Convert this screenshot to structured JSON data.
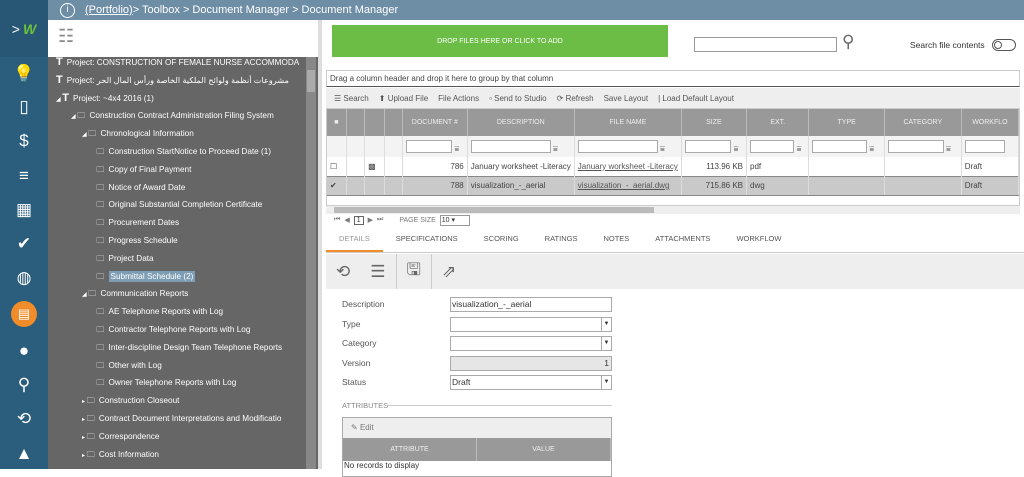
{
  "breadcrumb": {
    "portfolio": "(Portfolio)",
    "rest": " > Toolbox > Document Manager > Document Manager"
  },
  "rail": [
    "lightbulb-icon",
    "document-icon",
    "dollar-icon",
    "bars-icon",
    "building-icon",
    "check-icon",
    "globe-icon",
    "briefcase-icon",
    "user-icon",
    "search-icon",
    "history-icon",
    "graduation-icon"
  ],
  "tree": [
    {
      "label": "Project: CONSTRUCTION OF FEMALE NURSE ACCOMMODA",
      "level": 0,
      "icon": "T"
    },
    {
      "label": "Project: مشروعات أنظمة ولوائح الملكية الخاصة ورأس المال الحر",
      "level": 0,
      "icon": "T"
    },
    {
      "label": "Project: ~4x4 2016 (1)",
      "level": 0,
      "icon": "T",
      "arrow": true
    },
    {
      "label": "Construction Contract Administration Filing System",
      "level": 1,
      "icon": "folder",
      "arrow": true
    },
    {
      "label": "Chronological Information",
      "level": 2,
      "icon": "folder",
      "arrow": true
    },
    {
      "label": "Construction StartNotice to Proceed Date (1)",
      "level": 3,
      "icon": "folder"
    },
    {
      "label": "Copy of Final Payment",
      "level": 3,
      "icon": "folder"
    },
    {
      "label": "Notice of Award Date",
      "level": 3,
      "icon": "folder"
    },
    {
      "label": "Original Substantial Completion Certificate",
      "level": 3,
      "icon": "folder"
    },
    {
      "label": "Procurement Dates",
      "level": 3,
      "icon": "folder"
    },
    {
      "label": "Progress Schedule",
      "level": 3,
      "icon": "folder"
    },
    {
      "label": "Project Data",
      "level": 3,
      "icon": "folder"
    },
    {
      "label": "Submittal Schedule (2)",
      "level": 3,
      "icon": "folder",
      "selected": true
    },
    {
      "label": "Communication Reports",
      "level": 2,
      "icon": "folder",
      "arrow": true
    },
    {
      "label": "AE Telephone Reports with Log",
      "level": 3,
      "icon": "folder"
    },
    {
      "label": "Contractor Telephone Reports with Log",
      "level": 3,
      "icon": "folder"
    },
    {
      "label": "Inter-discipline Design Team Telephone Reports",
      "level": 3,
      "icon": "folder"
    },
    {
      "label": "Other with Log",
      "level": 3,
      "icon": "folder"
    },
    {
      "label": "Owner Telephone Reports with Log",
      "level": 3,
      "icon": "folder"
    },
    {
      "label": "Construction Closeout",
      "level": 2,
      "icon": "folder",
      "collapsed": true
    },
    {
      "label": "Contract Document Interpretations and Modificatio",
      "level": 2,
      "icon": "folder",
      "collapsed": true
    },
    {
      "label": "Correspondence",
      "level": 2,
      "icon": "folder",
      "collapsed": true
    },
    {
      "label": "Cost Information",
      "level": 2,
      "icon": "folder",
      "collapsed": true
    }
  ],
  "drop_label": "DROP FILES HERE OR CLICK TO ADD",
  "search_file_contents": "Search file contents",
  "group_hint": "Drag a column header and drop it here to group by that column",
  "toolbar": {
    "search": "Search",
    "upload": "Upload File",
    "file_actions": "File Actions",
    "send": "Send to Studio",
    "refresh": "Refresh",
    "save_layout": "Save Layout",
    "load_default": "| Load Default Layout"
  },
  "columns": [
    "DOCUMENT #",
    "DESCRIPTION",
    "FILE NAME",
    "SIZE",
    "EXT.",
    "TYPE",
    "CATEGORY",
    "WORKFLO"
  ],
  "rows": [
    {
      "doc": "786",
      "desc": "January worksheet -Literacy",
      "file": "January worksheet -Literacy",
      "size": "113.96 KB",
      "ext": "pdf",
      "type": "",
      "category": "",
      "workflow": "Draft",
      "checked": false
    },
    {
      "doc": "788",
      "desc": "visualization_-_aerial",
      "file": "visualization_-_aerial.dwg",
      "size": "715.86 KB",
      "ext": "dwg",
      "type": "",
      "category": "",
      "workflow": "Draft",
      "checked": true
    }
  ],
  "pager": {
    "page": "1",
    "page_size_label": "PAGE SIZE",
    "page_size": "10"
  },
  "tabs": [
    "DETAILS",
    "SPECIFICATIONS",
    "SCORING",
    "RATINGS",
    "NOTES",
    "ATTACHMENTS",
    "WORKFLOW"
  ],
  "form": {
    "description_label": "Description",
    "description": "visualization_-_aerial",
    "type_label": "Type",
    "type": "",
    "category_label": "Category",
    "category": "",
    "version_label": "Version",
    "version": "1",
    "status_label": "Status",
    "status": "Draft"
  },
  "attributes": {
    "title": "ATTRIBUTES",
    "edit": "Edit",
    "col_attribute": "ATTRIBUTE",
    "col_value": "VALUE",
    "empty": "No records to display"
  }
}
